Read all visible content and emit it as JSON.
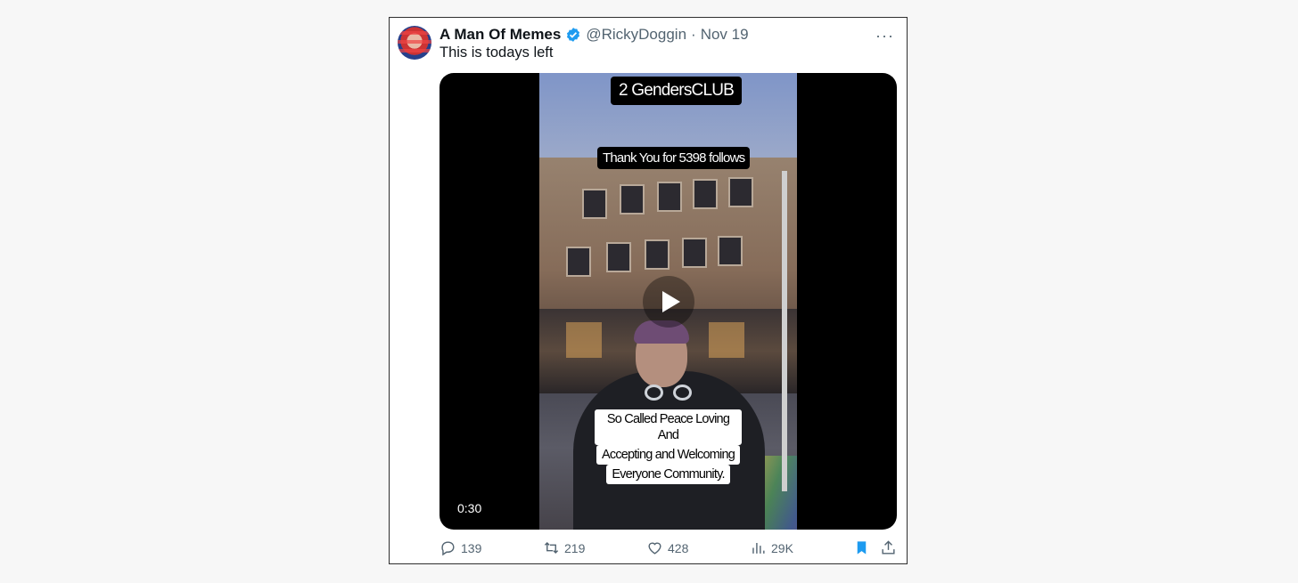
{
  "tweet": {
    "author_name": "A Man Of Memes",
    "handle": "@RickyDoggin",
    "separator": "·",
    "date": "Nov 19",
    "more_label": "···",
    "text": "This is todays left"
  },
  "media": {
    "caption_top": "2 GendersCLUB",
    "caption_mid": "Thank You for 5398 follows",
    "caption_bottom": [
      "So Called Peace Loving And",
      "Accepting and Welcoming",
      "Everyone Community."
    ],
    "duration": "0:30"
  },
  "actions": {
    "replies": "139",
    "retweets": "219",
    "likes": "428",
    "views": "29K"
  },
  "colors": {
    "verified": "#1d9bf0",
    "bookmark": "#1d9bf0",
    "muted": "#536471"
  },
  "icons": [
    "verified-badge-icon",
    "more-icon",
    "play-icon",
    "reply-icon",
    "retweet-icon",
    "like-icon",
    "views-icon",
    "bookmark-icon",
    "share-icon"
  ]
}
